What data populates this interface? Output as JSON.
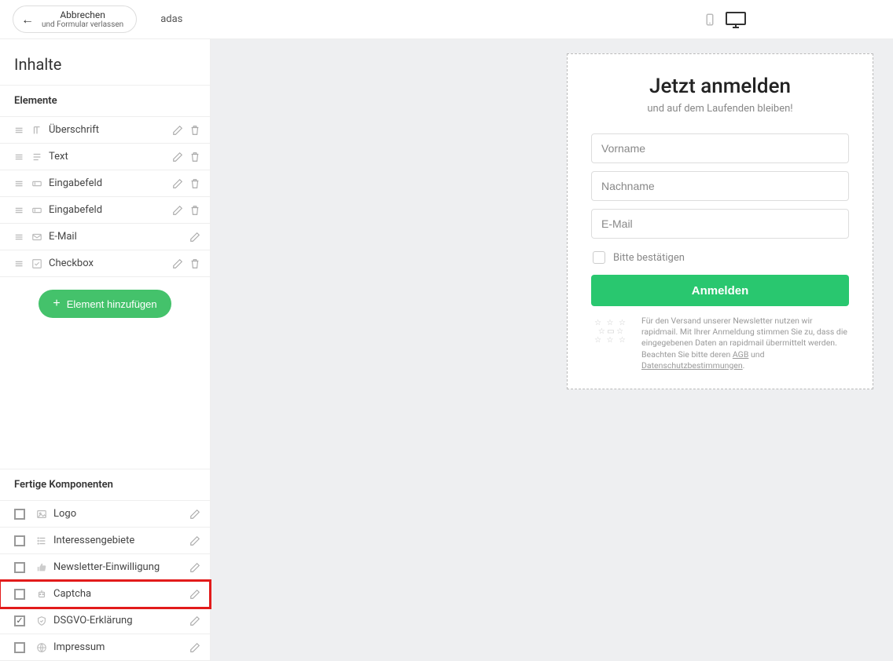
{
  "topbar": {
    "cancel_label": "Abbrechen",
    "cancel_sub": "und Formular verlassen",
    "form_name": "adas"
  },
  "sidebar": {
    "title": "Inhalte",
    "elements_header": "Elemente",
    "add_button": "Element hinzufügen",
    "elements": [
      {
        "label": "Überschrift",
        "type": "heading",
        "deletable": true
      },
      {
        "label": "Text",
        "type": "text",
        "deletable": true
      },
      {
        "label": "Eingabefeld",
        "type": "input",
        "deletable": true
      },
      {
        "label": "Eingabefeld",
        "type": "input",
        "deletable": true
      },
      {
        "label": "E-Mail",
        "type": "email",
        "deletable": false
      },
      {
        "label": "Checkbox",
        "type": "checkbox",
        "deletable": true
      }
    ],
    "components_header": "Fertige Komponenten",
    "components": [
      {
        "label": "Logo",
        "checked": false,
        "icon": "image"
      },
      {
        "label": "Interessengebiete",
        "checked": false,
        "icon": "list"
      },
      {
        "label": "Newsletter-Einwilligung",
        "checked": false,
        "icon": "thumb"
      },
      {
        "label": "Captcha",
        "checked": false,
        "icon": "robot",
        "highlight": true
      },
      {
        "label": "DSGVO-Erklärung",
        "checked": true,
        "icon": "shield"
      },
      {
        "label": "Impressum",
        "checked": false,
        "icon": "globe"
      }
    ]
  },
  "preview": {
    "title": "Jetzt anmelden",
    "subtitle": "und auf dem Laufenden bleiben!",
    "fields": {
      "firstname_placeholder": "Vorname",
      "lastname_placeholder": "Nachname",
      "email_placeholder": "E-Mail"
    },
    "confirm_label": "Bitte bestätigen",
    "submit_label": "Anmelden",
    "legal_prefix": "Für den Versand unserer Newsletter nutzen wir rapidmail. Mit Ihrer Anmeldung stimmen Sie zu, dass die eingegebenen Daten an rapidmail übermittelt werden. Beachten Sie bitte deren ",
    "legal_link1": "AGB",
    "legal_mid": " und ",
    "legal_link2": "Datenschutzbestimmungen",
    "legal_suffix": "."
  }
}
